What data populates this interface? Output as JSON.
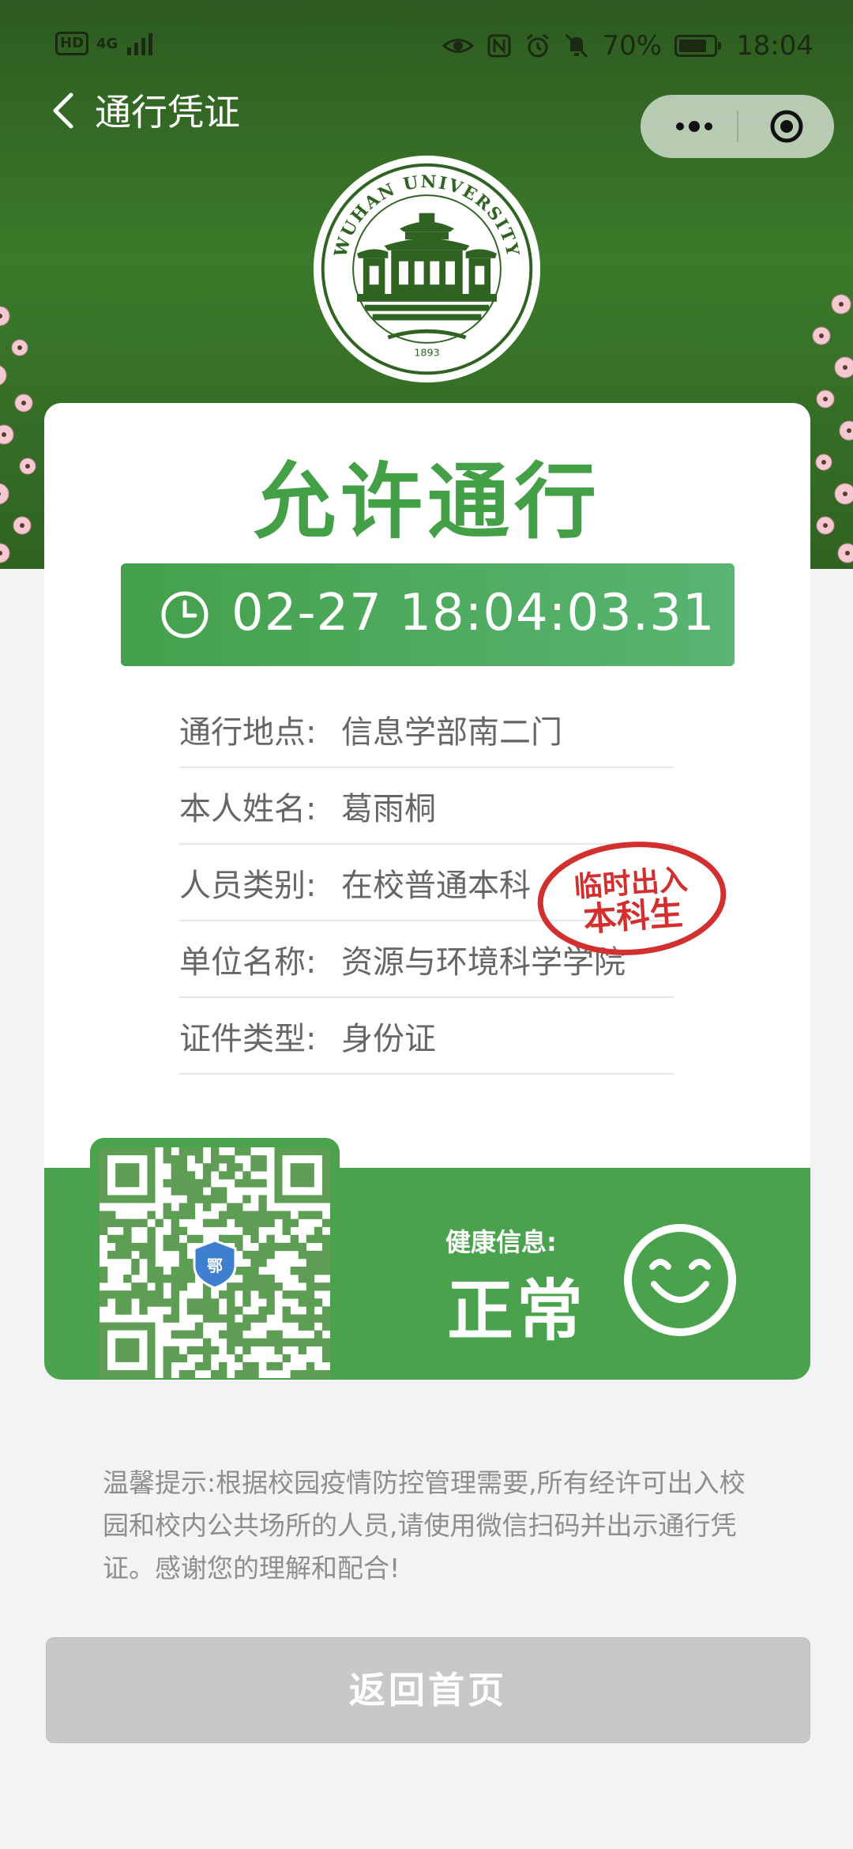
{
  "status_bar": {
    "hd": "HD",
    "network": "4G",
    "battery": "70%",
    "time": "18:04"
  },
  "nav": {
    "title": "通行凭证"
  },
  "logo": {
    "text": "WUHAN UNIVERSITY",
    "year": "1893"
  },
  "pass": {
    "status": "允许通行",
    "datetime": "02-27 18:04:03.31",
    "info": [
      {
        "label": "通行地点:",
        "value": "信息学部南二门"
      },
      {
        "label": "本人姓名:",
        "value": "葛雨桐"
      },
      {
        "label": "人员类别:",
        "value": "在校普通本科"
      },
      {
        "label": "单位名称:",
        "value": "资源与环境科学学院"
      },
      {
        "label": "证件类型:",
        "value": "身份证"
      }
    ],
    "stamp": {
      "line1": "临时出入",
      "line2": "本科生"
    }
  },
  "health": {
    "label": "健康信息:",
    "value": "正常",
    "qr_badge": "鄂"
  },
  "tip": "温馨提示:根据校园疫情防控管理需要,所有经许可出入校园和校内公共场所的人员,请使用微信扫码并出示通行凭证。感谢您的理解和配合!",
  "home_button": "返回首页",
  "colors": {
    "header_green": "#2f6322",
    "pass_green": "#43a047",
    "stamp_red": "#d32f2f",
    "button_gray": "#c8c8c8"
  },
  "icons": [
    "back-arrow-icon",
    "more-icon",
    "target-icon",
    "clock-icon",
    "smile-icon",
    "eye-icon",
    "nfc-icon",
    "alarm-icon",
    "mute-icon"
  ]
}
